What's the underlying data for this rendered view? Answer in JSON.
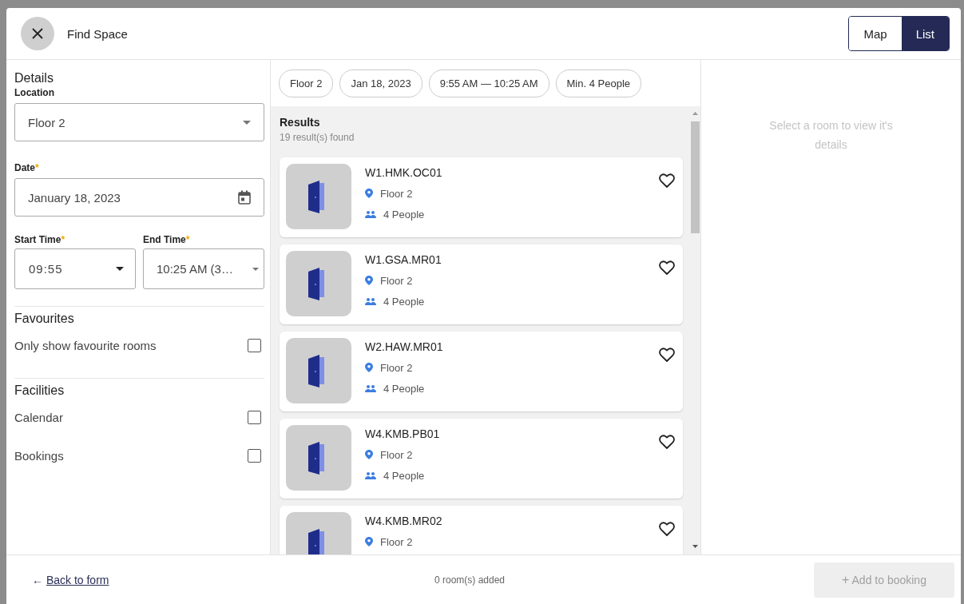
{
  "header": {
    "title": "Find Space",
    "view_toggle": [
      {
        "label": "Map",
        "selected": false
      },
      {
        "label": "List",
        "selected": true
      }
    ]
  },
  "details": {
    "heading": "Details",
    "location": {
      "label": "Location",
      "value": "Floor 2"
    },
    "date": {
      "label": "Date",
      "mark": "*",
      "value": "January 18, 2023"
    },
    "start_time": {
      "label": "Start Time",
      "mark": "*",
      "value": "09:55"
    },
    "end_time": {
      "label": "End Time",
      "mark": "*",
      "value": "10:25 AM (3…"
    }
  },
  "favourites": {
    "heading": "Favourites",
    "options": [
      {
        "label": "Only show favourite rooms",
        "checked": false
      }
    ]
  },
  "facilities": {
    "heading": "Facilities",
    "options": [
      {
        "label": "Calendar",
        "checked": false
      },
      {
        "label": "Bookings",
        "checked": false
      }
    ]
  },
  "filter_chips": [
    "Floor 2",
    "Jan 18, 2023",
    "9:55 AM — 10:25 AM",
    "Min. 4 People"
  ],
  "results": {
    "heading": "Results",
    "count": "19 result(s) found",
    "rooms": [
      {
        "name": "W1.HMK.OC01",
        "floor": "Floor 2",
        "capacity": "4 People",
        "favourite": false
      },
      {
        "name": "W1.GSA.MR01",
        "floor": "Floor 2",
        "capacity": "4 People",
        "favourite": false
      },
      {
        "name": "W2.HAW.MR01",
        "floor": "Floor 2",
        "capacity": "4 People",
        "favourite": false
      },
      {
        "name": "W4.KMB.PB01",
        "floor": "Floor 2",
        "capacity": "4 People",
        "favourite": false
      },
      {
        "name": "W4.KMB.MR02",
        "floor": "Floor 2",
        "favourite": false
      }
    ]
  },
  "detail_panel": {
    "hint": "Select a room to view it's details"
  },
  "footer": {
    "back_arrow": "←",
    "back_link": "Back to form",
    "added": "0 room(s) added",
    "add_button": {
      "icon": "+",
      "label": "Add to booking",
      "disabled": true
    }
  }
}
